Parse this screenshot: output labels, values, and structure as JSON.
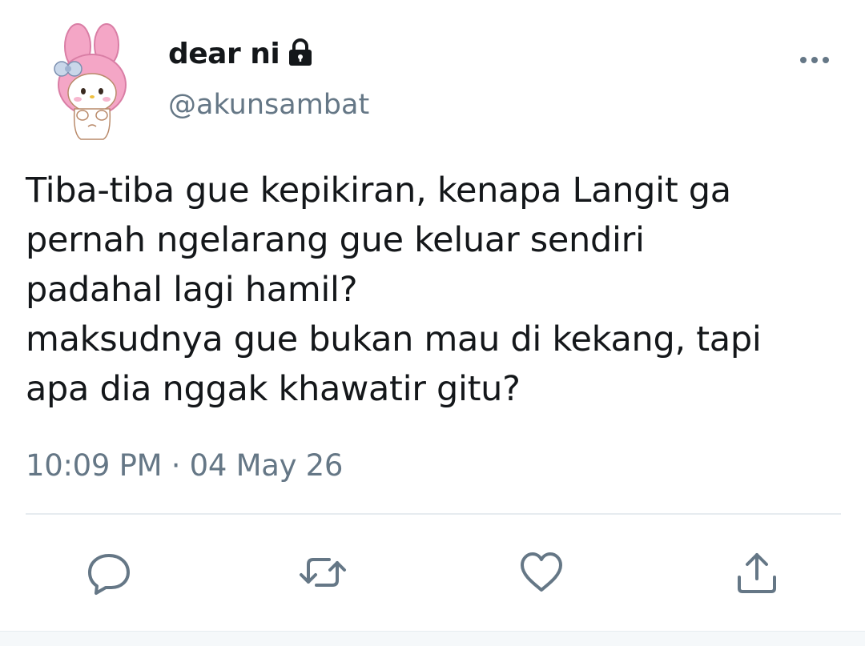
{
  "tweet": {
    "display_name": "dear ni",
    "handle": "@akunsambat",
    "text_lines": [
      "Tiba-tiba gue kepikiran, kenapa Langit ga",
      "pernah ngelarang gue keluar sendiri",
      "padahal lagi hamil?",
      "maksudnya gue bukan mau di kekang, tapi",
      "apa dia nggak khawatir gitu?"
    ],
    "time": "10:09 PM",
    "separator": "·",
    "date": "04 May 26"
  },
  "icons": {
    "lock": "lock-icon",
    "more": "more-options-icon",
    "reply": "reply-icon",
    "retweet": "retweet-icon",
    "like": "heart-icon",
    "share": "share-icon"
  },
  "colors": {
    "text": "#14171a",
    "secondary": "#657786",
    "divider": "#e6ecf0",
    "avatar_pink": "#f4a6c6"
  }
}
